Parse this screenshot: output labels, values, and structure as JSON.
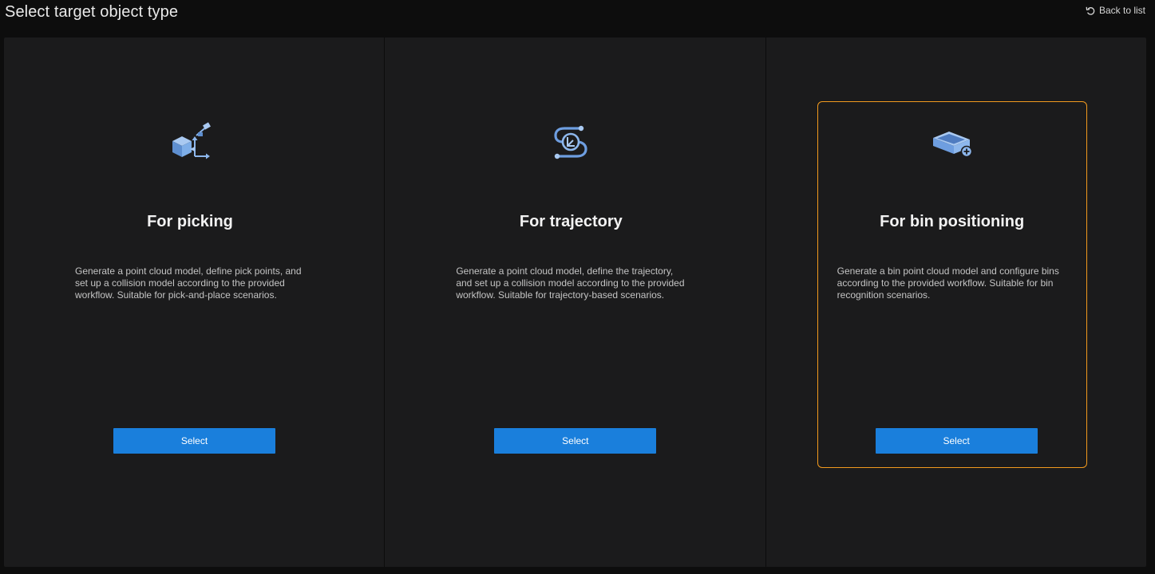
{
  "header": {
    "title": "Select target object type",
    "back_label": "Back to list"
  },
  "cards": [
    {
      "title": "For picking",
      "description": "Generate a point cloud model, define pick points, and set up a collision model according to the provided workflow. Suitable for pick-and-place scenarios.",
      "button_label": "Select",
      "icon": "picking-box-axes-icon",
      "selected": false
    },
    {
      "title": "For trajectory",
      "description": "Generate a point cloud model, define the trajectory, and set up a collision model according to the provided workflow. Suitable for trajectory-based scenarios.",
      "button_label": "Select",
      "icon": "trajectory-path-icon",
      "selected": false
    },
    {
      "title": "For bin positioning",
      "description": "Generate a bin point cloud model and configure bins according to the provided workflow. Suitable for bin recognition scenarios.",
      "button_label": "Select",
      "icon": "bin-add-icon",
      "selected": true
    }
  ],
  "colors": {
    "background": "#0d0d0d",
    "panel": "#1b1b1c",
    "accent_button": "#1a7fdc",
    "selected_border": "#f29a1e",
    "icon_blue": "#7eaee8"
  }
}
